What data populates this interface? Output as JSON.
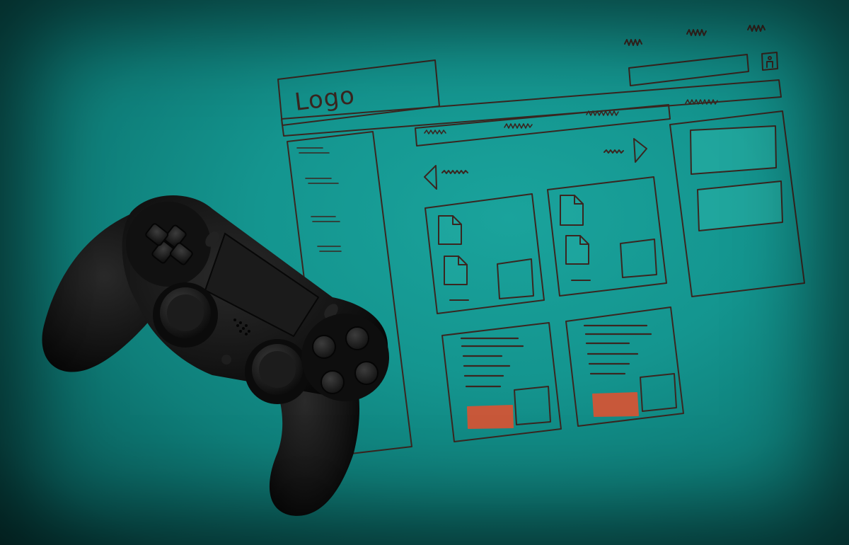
{
  "wireframe": {
    "logo_text": "Logo",
    "colors": {
      "ink": "#3a2620",
      "accent": "#c8583a",
      "panel_fill": "#29b3a8",
      "background": "#14958f"
    }
  },
  "controller": {
    "icon": "gamepad-icon",
    "color": "#141414"
  }
}
